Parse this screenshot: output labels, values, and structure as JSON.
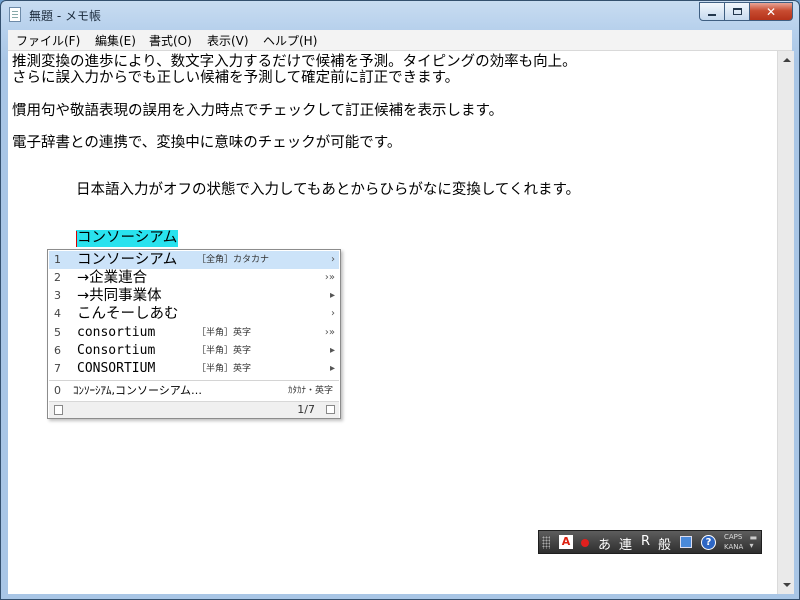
{
  "window": {
    "title": "無題 - メモ帳"
  },
  "menubar": {
    "items": [
      {
        "label": "ファイル(F)"
      },
      {
        "label": "編集(E)"
      },
      {
        "label": "書式(O)"
      },
      {
        "label": "表示(V)"
      },
      {
        "label": "ヘルプ(H)"
      }
    ]
  },
  "document": {
    "lines": [
      "推測変換の進歩により、数文字入力するだけで候補を予測。タイピングの効率も向上。",
      "さらに誤入力からでも正しい候補を予測して確定前に訂正できます。",
      "慣用句や敬語表現の誤用を入力時点でチェックして訂正候補を表示します。",
      "電子辞書との連携で、変換中に意味のチェックが可能です。",
      "日本語入力がオフの状態で入力してもあとからひらがなに変換してくれます。"
    ],
    "composing_text": "コンソーシアム"
  },
  "candidates": {
    "items": [
      {
        "num": "1",
        "text": "コンソーシアム",
        "note": "［全角］カタカナ",
        "arrow": "›",
        "selected": true
      },
      {
        "num": "2",
        "text": "→企業連合",
        "note": "",
        "arrow": "›»"
      },
      {
        "num": "3",
        "text": "→共同事業体",
        "note": "",
        "arrow": "▸"
      },
      {
        "num": "4",
        "text": "こんそーしあむ",
        "note": "",
        "arrow": "›"
      },
      {
        "num": "5",
        "text": "consortium",
        "note": "［半角］英字",
        "arrow": "›»"
      },
      {
        "num": "6",
        "text": "Consortium",
        "note": "［半角］英字",
        "arrow": "▸"
      },
      {
        "num": "7",
        "text": "CONSORTIUM",
        "note": "［半角］英字",
        "arrow": "▸"
      }
    ],
    "summary": {
      "num": "0",
      "text": "ｺﾝｿｰｼｱﾑ,コンソーシアム…",
      "note": "ｶﾀｶﾅ・英字"
    },
    "page": "1/7"
  },
  "ime_toolbar": {
    "logo": "A",
    "mode_hiragana": "あ",
    "mode_ren": "連",
    "mode_r": "R",
    "mode_general": "般",
    "help": "?",
    "caps": "CAPS",
    "kana": "KANA"
  }
}
